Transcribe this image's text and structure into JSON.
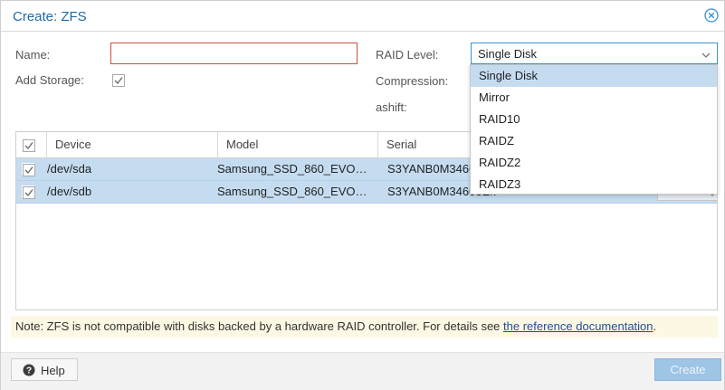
{
  "dialog": {
    "title": "Create: ZFS"
  },
  "icons": {
    "close": "close-circle-icon",
    "help": "question-circle-icon",
    "checkbox": "checkmark-icon",
    "dropdown": "chevron-down-icon"
  },
  "form": {
    "name_label": "Name:",
    "name_value": "",
    "add_storage_label": "Add Storage:",
    "add_storage_checked": true,
    "raid_level_label": "RAID Level:",
    "raid_level_value": "Single Disk",
    "compression_label": "Compression:",
    "ashift_label": "ashift:"
  },
  "raid_dropdown": {
    "options": [
      "Single Disk",
      "Mirror",
      "RAID10",
      "RAIDZ",
      "RAIDZ2",
      "RAIDZ3"
    ],
    "selected": "Single Disk"
  },
  "grid": {
    "columns": [
      "Device",
      "Model",
      "Serial"
    ],
    "rows": [
      {
        "checked": true,
        "device": "/dev/sda",
        "model": "Samsung_SSD_860_EVO…",
        "serial": "S3YANB0M3460"
      },
      {
        "checked": true,
        "device": "/dev/sdb",
        "model": "Samsung_SSD_860_EVO…",
        "serial": "S3YANB0M34603EM"
      }
    ]
  },
  "note": {
    "text": "Note: ZFS is not compatible with disks backed by a hardware RAID controller. For details see ",
    "link": "the reference documentation",
    "suffix": "."
  },
  "footer": {
    "help_label": "Help",
    "create_label": "Create"
  },
  "colors": {
    "accent": "#3892d4",
    "selected_row": "#c5dcf0",
    "title": "#1f6aa5",
    "invalid_border": "#c94f3f",
    "note_bg": "#fcf8e3"
  }
}
